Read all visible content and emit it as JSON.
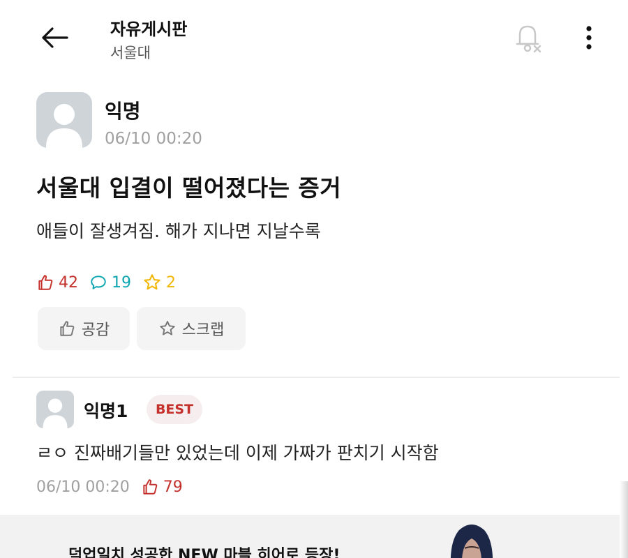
{
  "header": {
    "title": "자유게시판",
    "subtitle": "서울대",
    "back_icon": "arrow-left-icon",
    "notification_icon": "bell-off-icon",
    "more_icon": "more-vertical-icon"
  },
  "post": {
    "author": "익명",
    "time": "06/10 00:20",
    "title": "서울대 입결이 떨어졌다는 증거",
    "body": "애들이 잘생겨짐. 해가 지나면 지날수록",
    "likes": "42",
    "comments": "19",
    "scraps": "2",
    "like_button_label": "공감",
    "scrap_button_label": "스크랩"
  },
  "comment": {
    "author": "익명1",
    "badge": "BEST",
    "body": "ㄹㅇ 진짜배기들만 있었는데 이제 가짜가 판치기 시작함",
    "time": "06/10 00:20",
    "likes": "79"
  },
  "ad": {
    "text": "덕업일치 성공한 NEW 마블 히어로 등장!"
  },
  "colors": {
    "like": "#c4302b",
    "comment": "#0ca5b0",
    "scrap": "#f2b705",
    "muted": "#a0a0a0",
    "avatar_bg": "#cfd4d8"
  }
}
